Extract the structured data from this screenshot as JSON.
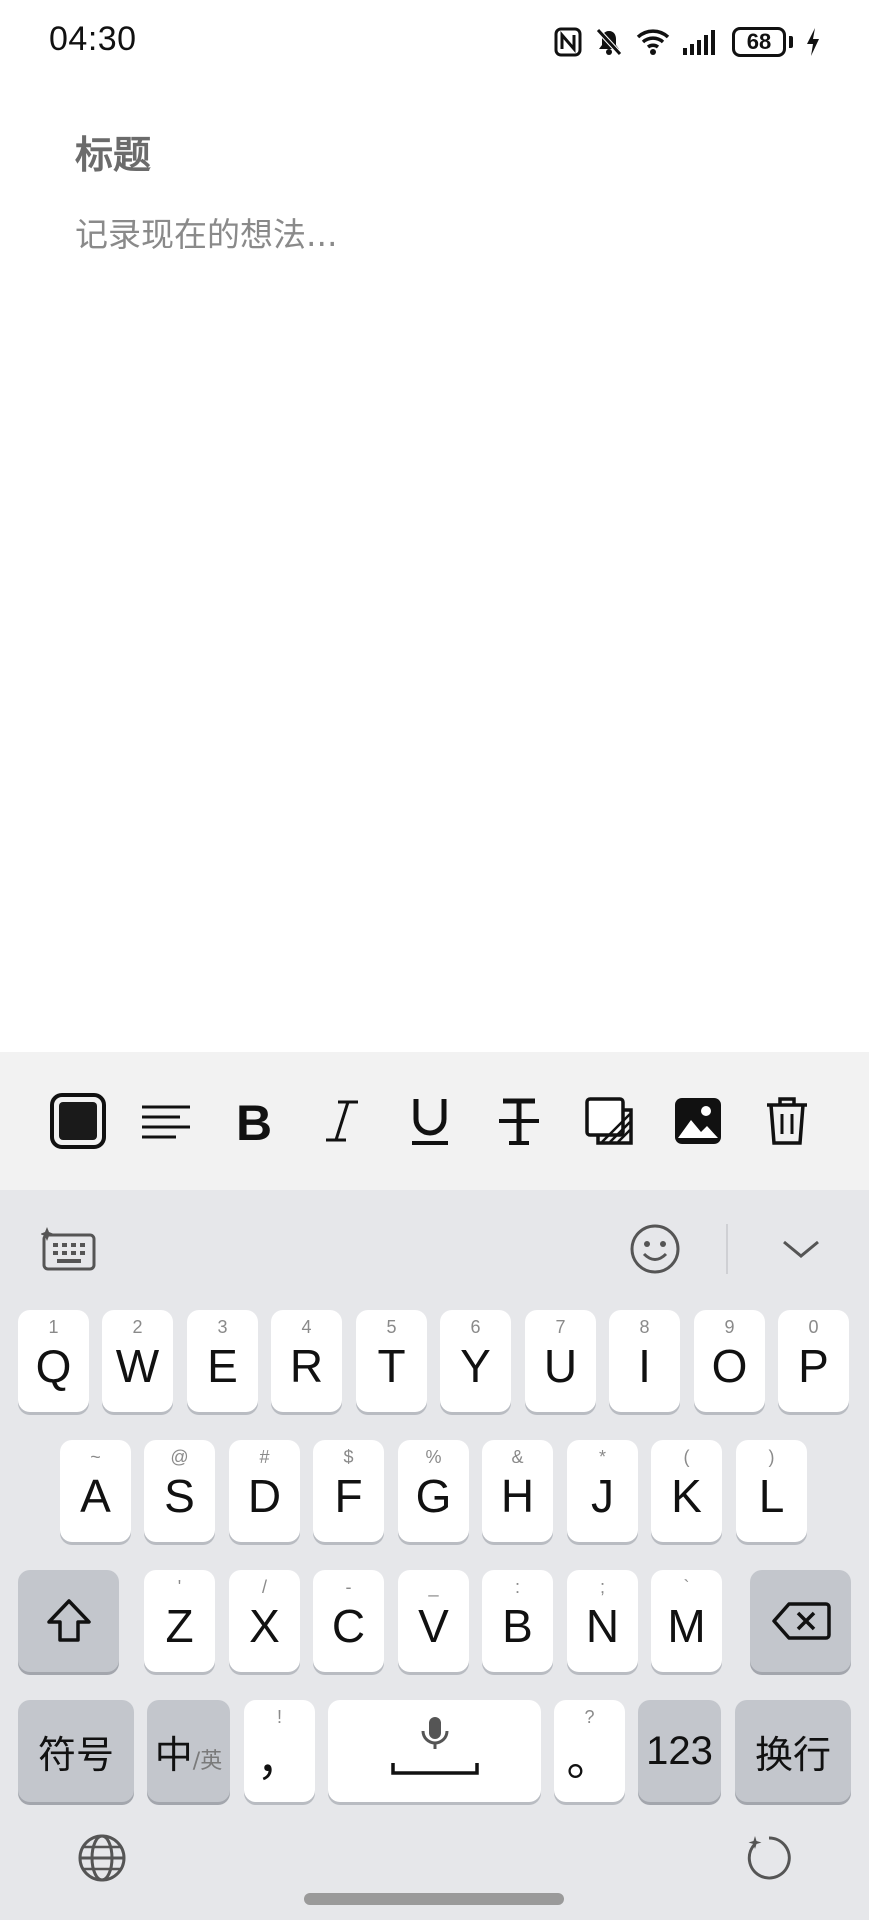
{
  "status_bar": {
    "time": "04:30",
    "battery": "68",
    "icons": [
      "nfc-icon",
      "mute-icon",
      "wifi-icon",
      "signal-icon",
      "battery-icon",
      "charging-icon"
    ]
  },
  "note": {
    "title_placeholder": "标题",
    "body_placeholder": "记录现在的想法..."
  },
  "format_toolbar": {
    "tools": [
      "color-swatch",
      "align-left",
      "bold",
      "italic",
      "underline",
      "strikethrough",
      "background",
      "image",
      "delete"
    ]
  },
  "keyboard": {
    "row1": [
      {
        "key": "Q",
        "hint": "1"
      },
      {
        "key": "W",
        "hint": "2"
      },
      {
        "key": "E",
        "hint": "3"
      },
      {
        "key": "R",
        "hint": "4"
      },
      {
        "key": "T",
        "hint": "5"
      },
      {
        "key": "Y",
        "hint": "6"
      },
      {
        "key": "U",
        "hint": "7"
      },
      {
        "key": "I",
        "hint": "8"
      },
      {
        "key": "O",
        "hint": "9"
      },
      {
        "key": "P",
        "hint": "0"
      }
    ],
    "row2": [
      {
        "key": "A",
        "hint": "~"
      },
      {
        "key": "S",
        "hint": "@"
      },
      {
        "key": "D",
        "hint": "#"
      },
      {
        "key": "F",
        "hint": "$"
      },
      {
        "key": "G",
        "hint": "%"
      },
      {
        "key": "H",
        "hint": "&"
      },
      {
        "key": "J",
        "hint": "*"
      },
      {
        "key": "K",
        "hint": "("
      },
      {
        "key": "L",
        "hint": ")"
      }
    ],
    "row3": [
      {
        "key": "Z",
        "hint": "'"
      },
      {
        "key": "X",
        "hint": "/"
      },
      {
        "key": "C",
        "hint": "-"
      },
      {
        "key": "V",
        "hint": "_"
      },
      {
        "key": "B",
        "hint": ":"
      },
      {
        "key": "N",
        "hint": ";"
      },
      {
        "key": "M",
        "hint": "`"
      }
    ],
    "symbols_label": "符号",
    "lang_label_main": "中",
    "lang_label_alt": "/英",
    "comma_key": "，",
    "comma_hint": "!",
    "period_key": "。",
    "period_hint": "?",
    "numbers_label": "123",
    "enter_label": "换行"
  }
}
